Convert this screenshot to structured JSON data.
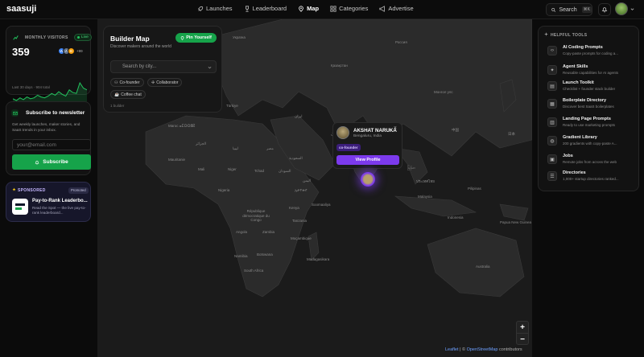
{
  "brand": "saasuji",
  "nav": [
    {
      "label": "Launches",
      "icon": "rocket-icon"
    },
    {
      "label": "Leaderboard",
      "icon": "trophy-icon"
    },
    {
      "label": "Map",
      "icon": "map-pin-icon",
      "active": true
    },
    {
      "label": "Categories",
      "icon": "grid-icon"
    },
    {
      "label": "Advertise",
      "icon": "megaphone-icon"
    }
  ],
  "search": {
    "label": "Search",
    "shortcut": "⌘K"
  },
  "visitors": {
    "title": "MONTHLY VISITORS",
    "live": "Live",
    "count": "359",
    "avatar_initials": [
      "W",
      "A",
      "B"
    ],
    "extra": "+99",
    "footer": "Last 30 days · 904 total",
    "sparkline": [
      8,
      6,
      9,
      7,
      10,
      8,
      9,
      12,
      10,
      9,
      11,
      14,
      12,
      16,
      13,
      11,
      18,
      15,
      14,
      26,
      20,
      18
    ]
  },
  "newsletter": {
    "title": "Subscribe to newsletter",
    "description": "Get weekly launches, maker stories, and SaaS trends in your inbox.",
    "placeholder": "your@email.com",
    "button": "Subscribe"
  },
  "sponsored": {
    "label": "SPONSORED",
    "badge": "Promoted",
    "title": "Pay-to-Rank Leaderbo...",
    "description": "Read the Spot — the live pay-to-rank leaderboard..."
  },
  "builder_map": {
    "title": "Builder Map",
    "subtitle": "Discover makers around the world",
    "pin_button": "Pin Yourself",
    "search_placeholder": "Search by city...",
    "chips": [
      "Co-founder",
      "Collaborator",
      "Coffee chat"
    ],
    "count": "1 builder"
  },
  "popup": {
    "name": "AKSHAT NARUKA",
    "location": "Bengaluru, India",
    "tag": "co-founder",
    "button": "View Profile"
  },
  "map_labels": {
    "russia": "Россия",
    "mongolia": "Монгол улс",
    "china": "中国",
    "kazakhstan": "Қазақстан",
    "iran": "ایران",
    "pakistan": "پاکستان",
    "india": "भारत",
    "egypt": "مصر",
    "libya": "ليبيا",
    "algeria": "الجزائر",
    "ksa": "السعودية",
    "morocco": "Maroc ⴰⵎⵔⵔⵓⴽ",
    "mali": "Mali",
    "niger": "Niger",
    "tchad": "Tchad",
    "sudan": "السودان",
    "mauritanie": "Mauritanie",
    "nigeria": "Nigeria",
    "ethiopia": "ኢትዮጵያ",
    "kenya": "Kenya",
    "tanzania": "Tanzania",
    "drc": "République démocratique du Congo",
    "angola": "Angola",
    "namibia": "Namibia",
    "south_africa": "South Africa",
    "madagascar": "Madagasikara",
    "mozambique": "Moçambique",
    "zambia": "Zambia",
    "botswana": "Botswana",
    "somalia": "Soomaaliya",
    "yemen": "اليمن",
    "turkey": "Türkiye",
    "ukraine": "Україна",
    "myanmar": "မြန်မာ",
    "thailand": "ประเทศไทย",
    "indonesia": "Indonesia",
    "japan": "日本",
    "australia": "Australia",
    "philippines": "Pilipinas",
    "malaysia": "Malaysia",
    "png": "Papua New Guinea"
  },
  "attribution": {
    "leaflet": "Leaflet",
    "sep": " | © ",
    "osm": "OpenStreetMap",
    "tail": " contributors"
  },
  "zoom": {
    "in": "+",
    "out": "−"
  },
  "tools": {
    "title": "HELPFUL TOOLS",
    "items": [
      {
        "title": "AI Coding Prompts",
        "desc": "Copy-paste prompts for coding a...",
        "icon": "code-icon"
      },
      {
        "title": "Agent Skills",
        "desc": "Reusable capabilities for AI agents",
        "icon": "sparkle-icon"
      },
      {
        "title": "Launch Toolkit",
        "desc": "Checklist + founder stack builder",
        "icon": "clipboard-icon"
      },
      {
        "title": "Boilerplate Directory",
        "desc": "Discover best SaaS boilerplates",
        "icon": "layers-icon"
      },
      {
        "title": "Landing Page Prompts",
        "desc": "Ready to use marketing prompts",
        "icon": "document-icon"
      },
      {
        "title": "Gradient Library",
        "desc": "200 gradients with copy-paste A...",
        "icon": "palette-icon"
      },
      {
        "title": "Jobs",
        "desc": "Remote jobs from across the web",
        "icon": "briefcase-icon"
      },
      {
        "title": "Directories",
        "desc": "1,000+ startup directories ranked...",
        "icon": "list-icon"
      }
    ]
  },
  "colors": {
    "accent_green": "#16a34a",
    "accent_purple": "#7c3aed",
    "bg": "#0b0b0b"
  }
}
